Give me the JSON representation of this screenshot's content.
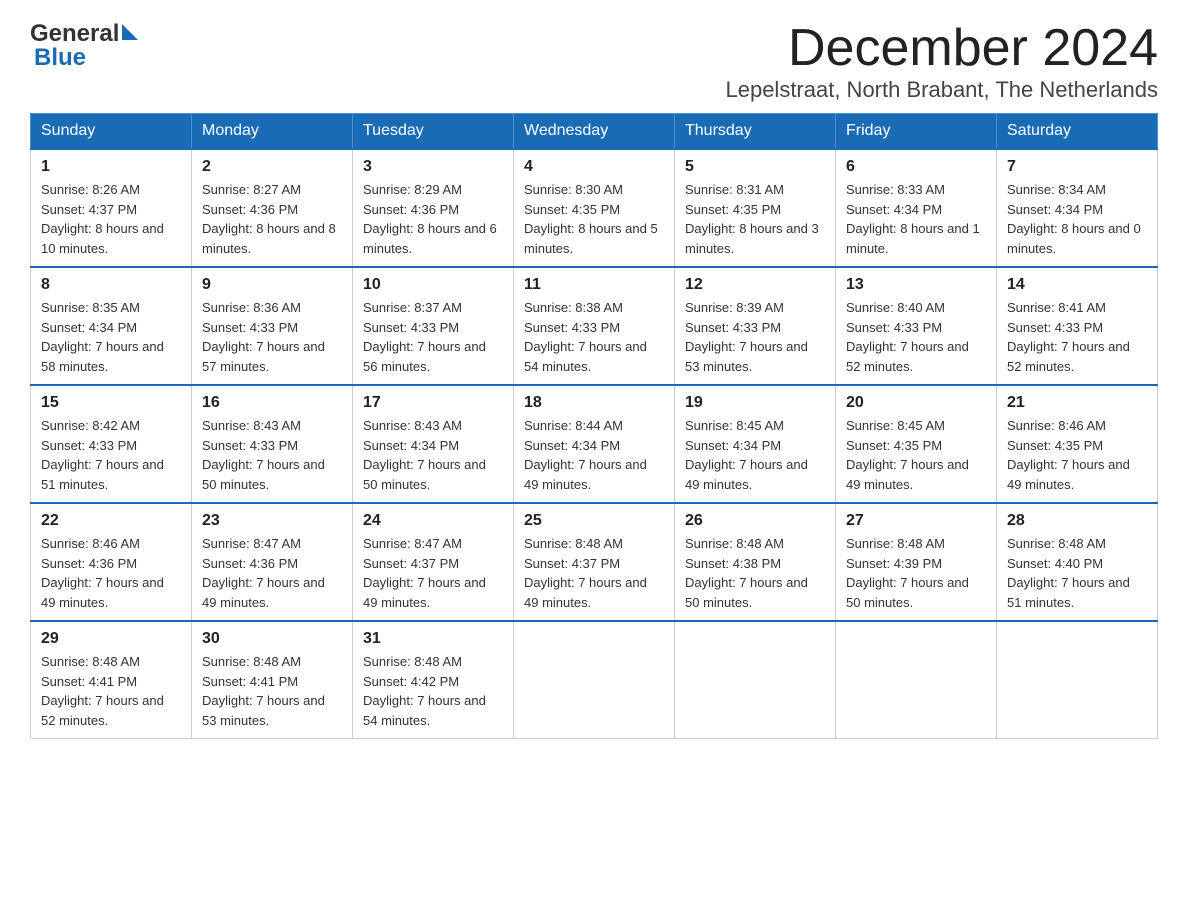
{
  "header": {
    "month_title": "December 2024",
    "location": "Lepelstraat, North Brabant, The Netherlands",
    "logo_general": "General",
    "logo_blue": "Blue"
  },
  "weekdays": [
    "Sunday",
    "Monday",
    "Tuesday",
    "Wednesday",
    "Thursday",
    "Friday",
    "Saturday"
  ],
  "weeks": [
    [
      {
        "day": "1",
        "sunrise": "8:26 AM",
        "sunset": "4:37 PM",
        "daylight": "8 hours and 10 minutes."
      },
      {
        "day": "2",
        "sunrise": "8:27 AM",
        "sunset": "4:36 PM",
        "daylight": "8 hours and 8 minutes."
      },
      {
        "day": "3",
        "sunrise": "8:29 AM",
        "sunset": "4:36 PM",
        "daylight": "8 hours and 6 minutes."
      },
      {
        "day": "4",
        "sunrise": "8:30 AM",
        "sunset": "4:35 PM",
        "daylight": "8 hours and 5 minutes."
      },
      {
        "day": "5",
        "sunrise": "8:31 AM",
        "sunset": "4:35 PM",
        "daylight": "8 hours and 3 minutes."
      },
      {
        "day": "6",
        "sunrise": "8:33 AM",
        "sunset": "4:34 PM",
        "daylight": "8 hours and 1 minute."
      },
      {
        "day": "7",
        "sunrise": "8:34 AM",
        "sunset": "4:34 PM",
        "daylight": "8 hours and 0 minutes."
      }
    ],
    [
      {
        "day": "8",
        "sunrise": "8:35 AM",
        "sunset": "4:34 PM",
        "daylight": "7 hours and 58 minutes."
      },
      {
        "day": "9",
        "sunrise": "8:36 AM",
        "sunset": "4:33 PM",
        "daylight": "7 hours and 57 minutes."
      },
      {
        "day": "10",
        "sunrise": "8:37 AM",
        "sunset": "4:33 PM",
        "daylight": "7 hours and 56 minutes."
      },
      {
        "day": "11",
        "sunrise": "8:38 AM",
        "sunset": "4:33 PM",
        "daylight": "7 hours and 54 minutes."
      },
      {
        "day": "12",
        "sunrise": "8:39 AM",
        "sunset": "4:33 PM",
        "daylight": "7 hours and 53 minutes."
      },
      {
        "day": "13",
        "sunrise": "8:40 AM",
        "sunset": "4:33 PM",
        "daylight": "7 hours and 52 minutes."
      },
      {
        "day": "14",
        "sunrise": "8:41 AM",
        "sunset": "4:33 PM",
        "daylight": "7 hours and 52 minutes."
      }
    ],
    [
      {
        "day": "15",
        "sunrise": "8:42 AM",
        "sunset": "4:33 PM",
        "daylight": "7 hours and 51 minutes."
      },
      {
        "day": "16",
        "sunrise": "8:43 AM",
        "sunset": "4:33 PM",
        "daylight": "7 hours and 50 minutes."
      },
      {
        "day": "17",
        "sunrise": "8:43 AM",
        "sunset": "4:34 PM",
        "daylight": "7 hours and 50 minutes."
      },
      {
        "day": "18",
        "sunrise": "8:44 AM",
        "sunset": "4:34 PM",
        "daylight": "7 hours and 49 minutes."
      },
      {
        "day": "19",
        "sunrise": "8:45 AM",
        "sunset": "4:34 PM",
        "daylight": "7 hours and 49 minutes."
      },
      {
        "day": "20",
        "sunrise": "8:45 AM",
        "sunset": "4:35 PM",
        "daylight": "7 hours and 49 minutes."
      },
      {
        "day": "21",
        "sunrise": "8:46 AM",
        "sunset": "4:35 PM",
        "daylight": "7 hours and 49 minutes."
      }
    ],
    [
      {
        "day": "22",
        "sunrise": "8:46 AM",
        "sunset": "4:36 PM",
        "daylight": "7 hours and 49 minutes."
      },
      {
        "day": "23",
        "sunrise": "8:47 AM",
        "sunset": "4:36 PM",
        "daylight": "7 hours and 49 minutes."
      },
      {
        "day": "24",
        "sunrise": "8:47 AM",
        "sunset": "4:37 PM",
        "daylight": "7 hours and 49 minutes."
      },
      {
        "day": "25",
        "sunrise": "8:48 AM",
        "sunset": "4:37 PM",
        "daylight": "7 hours and 49 minutes."
      },
      {
        "day": "26",
        "sunrise": "8:48 AM",
        "sunset": "4:38 PM",
        "daylight": "7 hours and 50 minutes."
      },
      {
        "day": "27",
        "sunrise": "8:48 AM",
        "sunset": "4:39 PM",
        "daylight": "7 hours and 50 minutes."
      },
      {
        "day": "28",
        "sunrise": "8:48 AM",
        "sunset": "4:40 PM",
        "daylight": "7 hours and 51 minutes."
      }
    ],
    [
      {
        "day": "29",
        "sunrise": "8:48 AM",
        "sunset": "4:41 PM",
        "daylight": "7 hours and 52 minutes."
      },
      {
        "day": "30",
        "sunrise": "8:48 AM",
        "sunset": "4:41 PM",
        "daylight": "7 hours and 53 minutes."
      },
      {
        "day": "31",
        "sunrise": "8:48 AM",
        "sunset": "4:42 PM",
        "daylight": "7 hours and 54 minutes."
      },
      null,
      null,
      null,
      null
    ]
  ]
}
